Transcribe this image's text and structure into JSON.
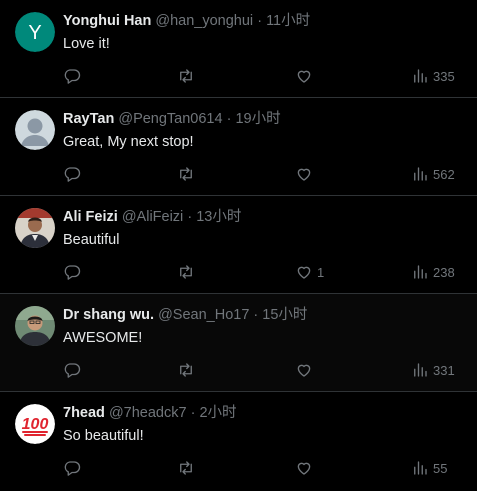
{
  "colors": {
    "background": "#000000",
    "text_primary": "#e7e9ea",
    "text_secondary": "#71767b",
    "divider": "#2f3336"
  },
  "replies": [
    {
      "display_name": "Yonghui Han",
      "handle": "@han_yonghui",
      "separator": "·",
      "time": "11小时",
      "text": "Love it!",
      "avatar": {
        "kind": "letter",
        "letter": "Y",
        "color": "#00897b"
      },
      "likes": "",
      "views": "335"
    },
    {
      "display_name": "RayTan",
      "handle": "@PengTan0614",
      "separator": "·",
      "time": "19小时",
      "text": "Great, My next stop!",
      "avatar": {
        "kind": "default-silhouette"
      },
      "likes": "",
      "views": "562"
    },
    {
      "display_name": "Ali Feizi",
      "handle": "@AliFeizi",
      "separator": "·",
      "time": "13小时",
      "text": "Beautiful",
      "avatar": {
        "kind": "photo"
      },
      "likes": "1",
      "views": "238"
    },
    {
      "display_name": "Dr shang wu.",
      "handle": "@Sean_Ho17",
      "separator": "·",
      "time": "15小时",
      "text": "AWESOME!",
      "avatar": {
        "kind": "photo"
      },
      "likes": "",
      "views": "331"
    },
    {
      "display_name": "7head",
      "handle": "@7headck7",
      "separator": "·",
      "time": "2小时",
      "text": "So beautiful!",
      "avatar": {
        "kind": "emoji-100"
      },
      "likes": "",
      "views": "55"
    }
  ]
}
